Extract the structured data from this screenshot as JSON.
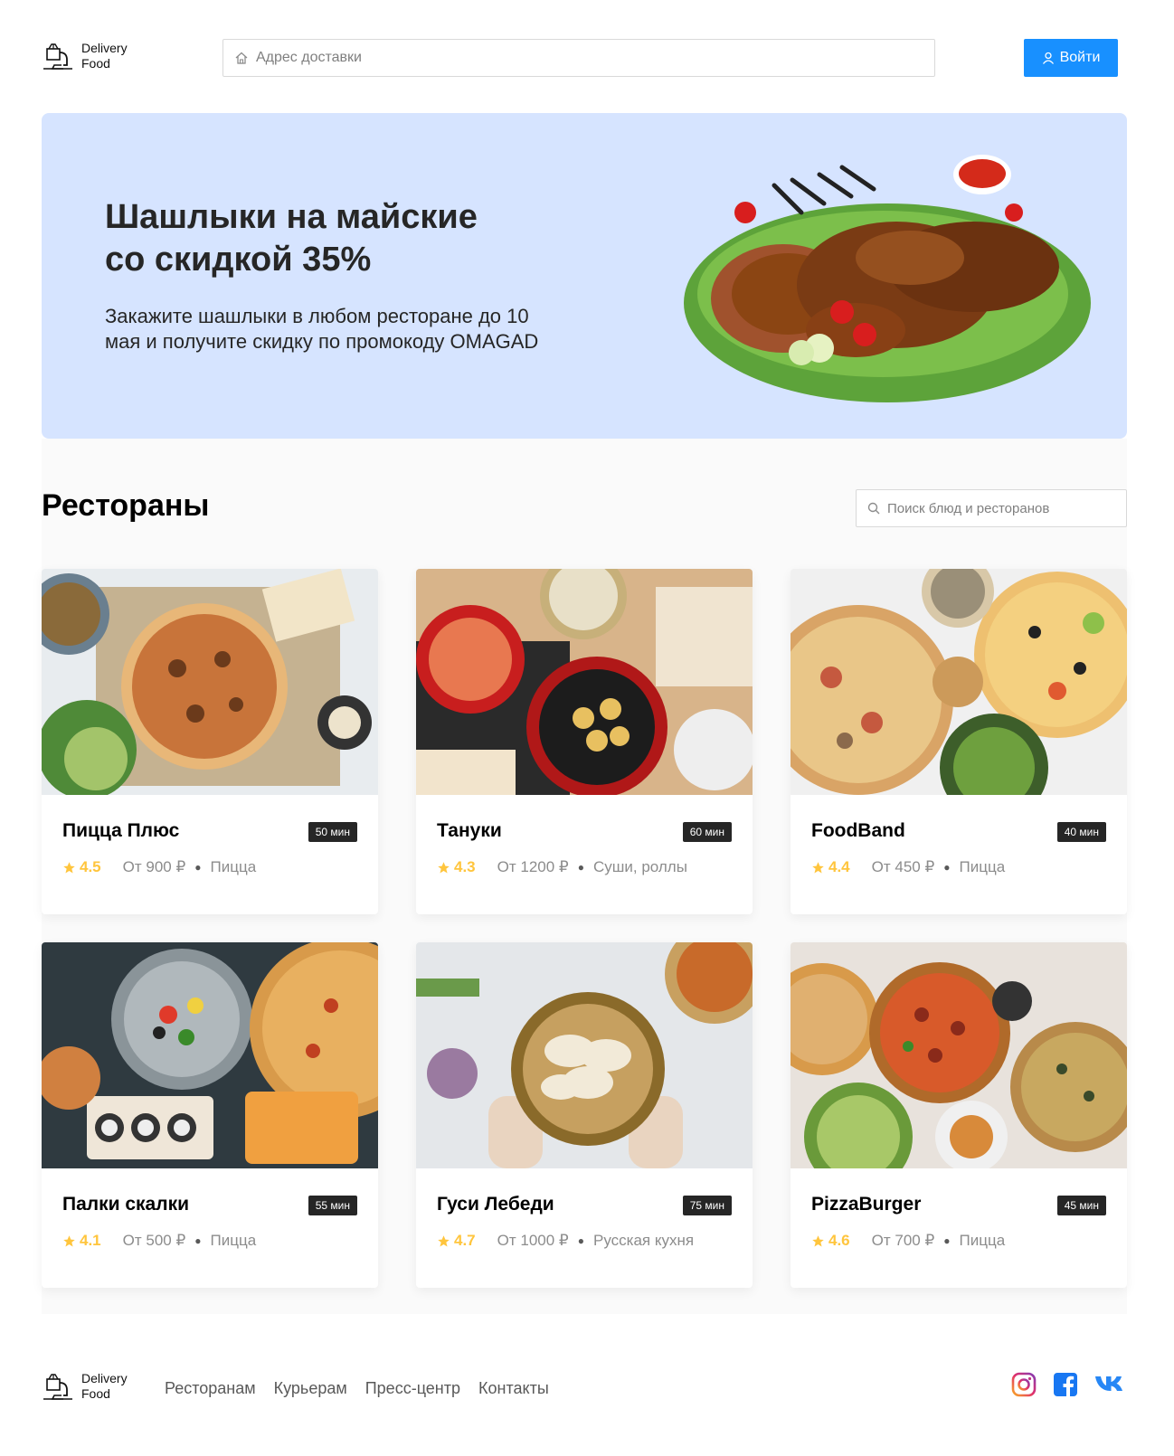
{
  "header": {
    "logo_line1": "Delivery",
    "logo_line2": "Food",
    "address_placeholder": "Адрес доставки",
    "login_label": "Войти"
  },
  "promo": {
    "title_line1": "Шашлыки на майские",
    "title_line2": "со скидкой 35%",
    "text_line1": "Закажите шашлыки в любом ресторане до 10",
    "text_line2": "мая и получите скидку по промокоду OMAGAD"
  },
  "restaurants": {
    "title": "Рестораны",
    "search_placeholder": "Поиск блюд и ресторанов",
    "items": [
      {
        "name": "Пицца Плюс",
        "time": "50 мин",
        "rating": "4.5",
        "price": "От 900 ₽",
        "category": "Пицца"
      },
      {
        "name": "Тануки",
        "time": "60 мин",
        "rating": "4.3",
        "price": "От 1200 ₽",
        "category": "Суши, роллы"
      },
      {
        "name": "FoodBand",
        "time": "40 мин",
        "rating": "4.4",
        "price": "От 450 ₽",
        "category": "Пицца"
      },
      {
        "name": "Палки скалки",
        "time": "55 мин",
        "rating": "4.1",
        "price": "От 500 ₽",
        "category": "Пицца"
      },
      {
        "name": "Гуси Лебеди",
        "time": "75 мин",
        "rating": "4.7",
        "price": "От 1000 ₽",
        "category": "Русская кухня"
      },
      {
        "name": "PizzaBurger",
        "time": "45 мин",
        "rating": "4.6",
        "price": "От 700 ₽",
        "category": "Пицца"
      }
    ]
  },
  "footer": {
    "logo_line1": "Delivery",
    "logo_line2": "Food",
    "links": [
      "Ресторанам",
      "Курьерам",
      "Пресс-центр",
      "Контакты"
    ],
    "social_icons": [
      "instagram-icon",
      "facebook-icon",
      "vk-icon"
    ]
  },
  "colors": {
    "accent": "#1890ff",
    "promo_bg": "#d6e4ff",
    "rating": "#ffc53d",
    "badge_bg": "#262626"
  }
}
